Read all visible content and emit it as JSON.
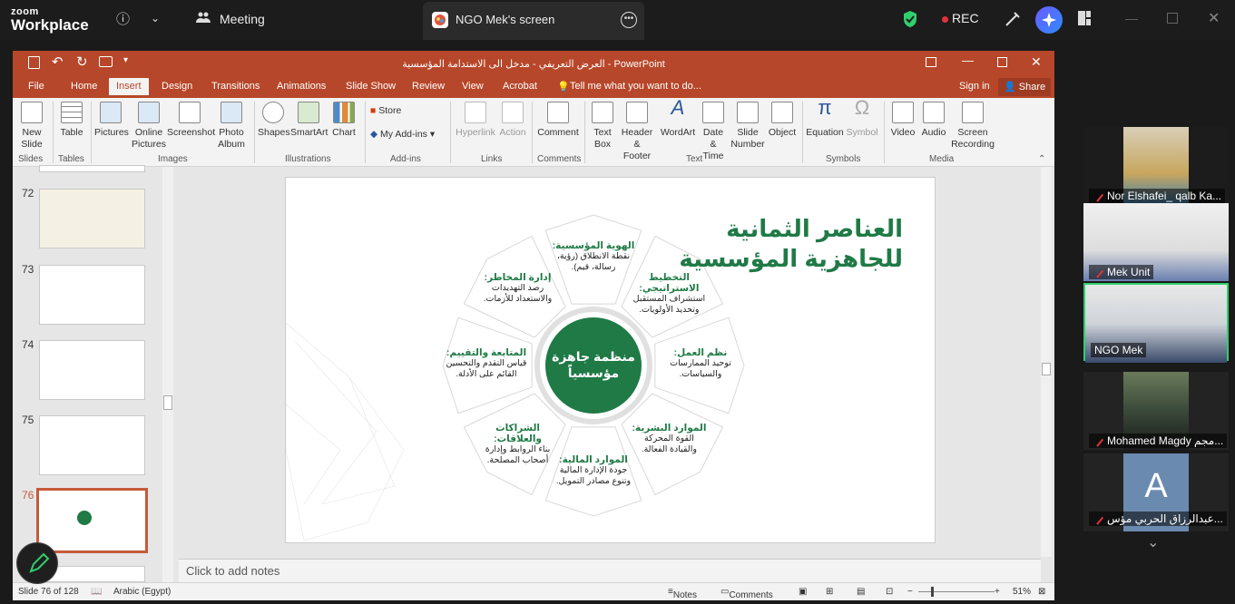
{
  "zoom": {
    "brand_small": "zoom",
    "brand_big": "Workplace",
    "meeting_label": "Meeting",
    "share_tab_label": "NGO Mek's screen",
    "rec_label": "REC"
  },
  "ppt": {
    "title": "العرض التعريفي - مدخل الى الاستدامة المؤسسية - PowerPoint",
    "tabs": [
      "File",
      "Home",
      "Insert",
      "Design",
      "Transitions",
      "Animations",
      "Slide Show",
      "Review",
      "View",
      "Acrobat"
    ],
    "active_tab": "Insert",
    "tell_me": "Tell me what you want to do...",
    "sign_in": "Sign in",
    "share": "Share",
    "ribbon": {
      "new_slide": "New\nSlide",
      "table": "Table",
      "pictures": "Pictures",
      "online_pictures": "Online\nPictures",
      "screenshot": "Screenshot",
      "photo_album": "Photo\nAlbum",
      "shapes": "Shapes",
      "smartart": "SmartArt",
      "chart": "Chart",
      "store": "Store",
      "my_addins": "My Add-ins",
      "hyperlink": "Hyperlink",
      "action": "Action",
      "comment": "Comment",
      "text_box": "Text\nBox",
      "header_footer": "Header\n& Footer",
      "wordart": "WordArt",
      "date_time": "Date &\nTime",
      "slide_number": "Slide\nNumber",
      "object": "Object",
      "equation": "Equation",
      "symbol": "Symbol",
      "video": "Video",
      "audio": "Audio",
      "screen_recording": "Screen\nRecording",
      "groups": {
        "slides": "Slides",
        "tables": "Tables",
        "images": "Images",
        "illustrations": "Illustrations",
        "addins": "Add-ins",
        "links": "Links",
        "comments": "Comments",
        "text": "Text",
        "symbols": "Symbols",
        "media": "Media"
      }
    },
    "thumbs": [
      "72",
      "73",
      "74",
      "75",
      "76"
    ],
    "selected_thumb": "76",
    "notes_placeholder": "Click to add notes",
    "status": {
      "slide_of": "Slide 76 of 128",
      "language": "Arabic (Egypt)",
      "notes": "Notes",
      "comments": "Comments",
      "zoom": "51%"
    }
  },
  "slide": {
    "title_line1": "العناصر الثمانية",
    "title_line2": "للجاهزية المؤسسية",
    "center_line1": "منظمة جاهزة",
    "center_line2": "مؤسسياً",
    "petals": [
      {
        "title": "الهوية المؤسسية:",
        "body1": "نقطة الانطلاق (رؤية،",
        "body2": "رسالة، قيم)."
      },
      {
        "title": "التخطيط الاستراتيجي:",
        "body1": "استشراف المستقبل",
        "body2": "وتحديد الأولويات."
      },
      {
        "title": "نظم العمل:",
        "body1": "توحيد الممارسات",
        "body2": "والسياسات."
      },
      {
        "title": "الموارد البشرية:",
        "body1": "القوة المحركة",
        "body2": "والقيادة الفعالة."
      },
      {
        "title": "الموارد المالية:",
        "body1": "جودة الإدارة المالية",
        "body2": "وتنوع مصادر التمويل."
      },
      {
        "title": "الشراكات والعلاقات:",
        "body1": "بناء الروابط وإدارة",
        "body2": "أصحاب المصلحة."
      },
      {
        "title": "المتابعة والتقييم:",
        "body1": "قياس التقدم والتحسين",
        "body2": "القائم على الأدلة."
      },
      {
        "title": "إدارة المخاطر:",
        "body1": "رصد التهديدات",
        "body2": "والاستعداد للأزمات."
      }
    ]
  },
  "participants": [
    {
      "name": "Nor Elshafei_ qalb Ka..."
    },
    {
      "name": "Mek Unit"
    },
    {
      "name": "NGO Mek"
    },
    {
      "name": "Mohamed Magdy مجم..."
    },
    {
      "name": "عبدالرزاق الحربي مؤس...",
      "initial": "A"
    }
  ],
  "colors": {
    "accent": "#b7472a",
    "brand_green": "#1f7a46",
    "zoom_active": "#2fcf6d"
  }
}
